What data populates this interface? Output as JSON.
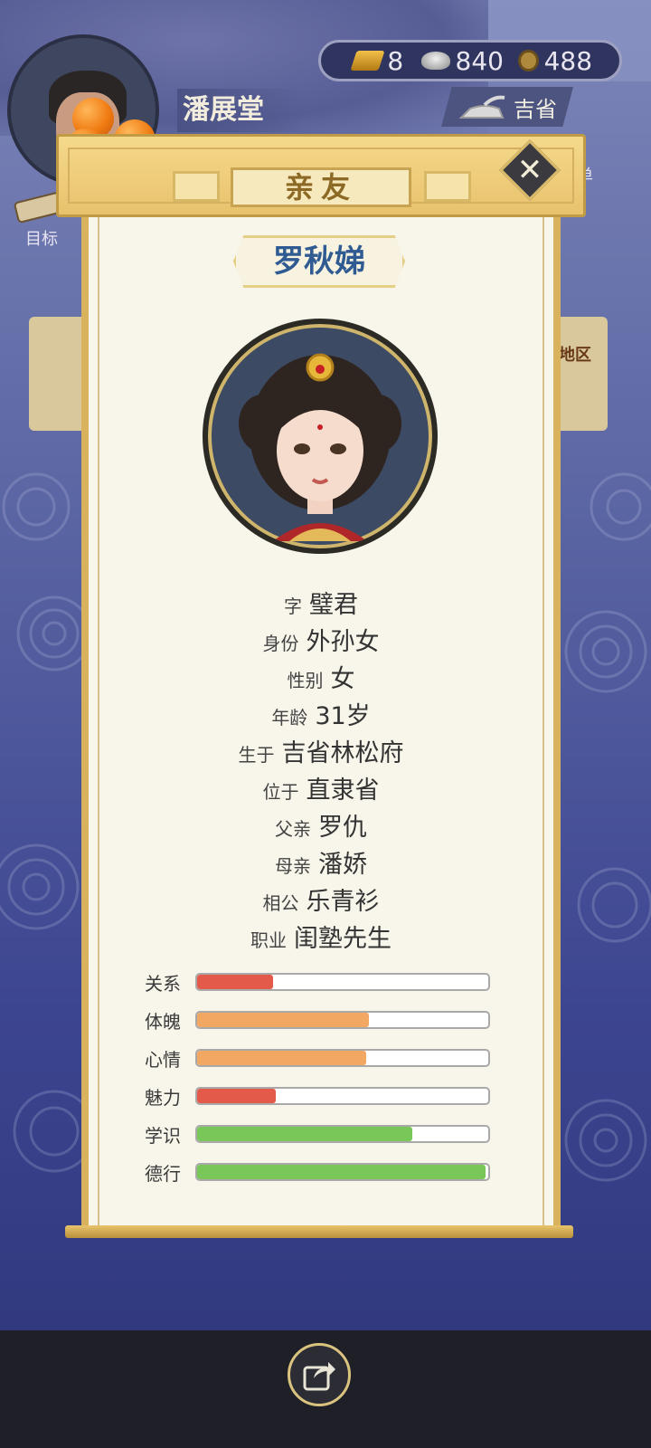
{
  "player": {
    "name": "潘展堂"
  },
  "currency": {
    "gold": "8",
    "silver": "840",
    "coins": "488"
  },
  "region": {
    "label": "吉省"
  },
  "side_left": {
    "label": "目标"
  },
  "side_right": {
    "label": "菜单"
  },
  "behind_card_right": {
    "label": "地区"
  },
  "dialog": {
    "title": "亲友",
    "person_name": "罗秋娣",
    "info": [
      {
        "key": "字",
        "value": "璧君"
      },
      {
        "key": "身份",
        "value": "外孙女"
      },
      {
        "key": "性别",
        "value": "女"
      },
      {
        "key": "年龄",
        "value": "31岁"
      },
      {
        "key": "生于",
        "value": "吉省林松府"
      },
      {
        "key": "位于",
        "value": "直隶省"
      },
      {
        "key": "父亲",
        "value": "罗仇"
      },
      {
        "key": "母亲",
        "value": "潘娇"
      },
      {
        "key": "相公",
        "value": "乐青衫"
      },
      {
        "key": "职业",
        "value": "闺塾先生"
      }
    ],
    "stats": [
      {
        "key": "关系",
        "value": 0.26,
        "color": "#e45a4a"
      },
      {
        "key": "体魄",
        "value": 0.59,
        "color": "#f2a763"
      },
      {
        "key": "心情",
        "value": 0.58,
        "color": "#f2a763"
      },
      {
        "key": "魅力",
        "value": 0.27,
        "color": "#e45a4a"
      },
      {
        "key": "学识",
        "value": 0.74,
        "color": "#78c758"
      },
      {
        "key": "德行",
        "value": 0.99,
        "color": "#78c758"
      }
    ]
  },
  "icons": {
    "close": "close-icon",
    "share": "share-icon",
    "gold": "gold-bar-icon",
    "silver": "silver-ingot-icon",
    "coin": "copper-coin-icon"
  }
}
